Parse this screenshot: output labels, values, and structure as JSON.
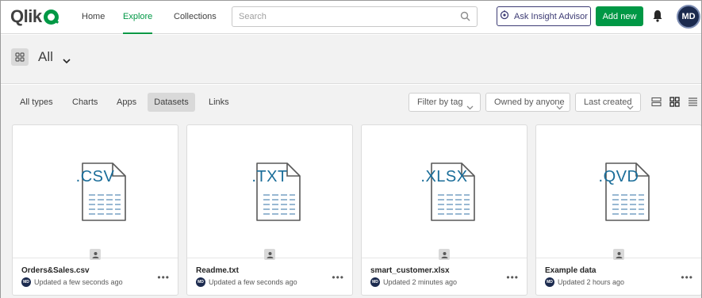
{
  "nav": {
    "logo_text": "Qlik",
    "tabs": [
      {
        "label": "Home"
      },
      {
        "label": "Explore"
      },
      {
        "label": "Collections"
      }
    ],
    "active_tab": "Explore",
    "search_placeholder": "Search",
    "insight_label": "Ask Insight Advisor",
    "addnew_label": "Add new",
    "avatar_initials": "MD"
  },
  "space": {
    "title": "All"
  },
  "filters": {
    "tabs": [
      {
        "label": "All types"
      },
      {
        "label": "Charts"
      },
      {
        "label": "Apps"
      },
      {
        "label": "Datasets"
      },
      {
        "label": "Links"
      }
    ],
    "active_tab": "Datasets",
    "filter_by_tag": "Filter by tag",
    "owned_by": "Owned by anyone",
    "sort": "Last created"
  },
  "cards": [
    {
      "ext": ".CSV",
      "name": "Orders&Sales.csv",
      "updated": "Updated a few seconds ago",
      "avatar": "MD"
    },
    {
      "ext": ".TXT",
      "name": "Readme.txt",
      "updated": "Updated a few seconds ago",
      "avatar": "MD"
    },
    {
      "ext": ".XLSX",
      "name": "smart_customer.xlsx",
      "updated": "Updated 2 minutes ago",
      "avatar": "MD"
    },
    {
      "ext": ".QVD",
      "name": "Example data",
      "updated": "Updated 2 hours ago",
      "avatar": "MD"
    }
  ],
  "colors": {
    "brand_green": "#009845",
    "insight_purple": "#3d3b74",
    "file_ext_blue": "#1a6d99",
    "avatar_navy": "#1b2a4e"
  }
}
